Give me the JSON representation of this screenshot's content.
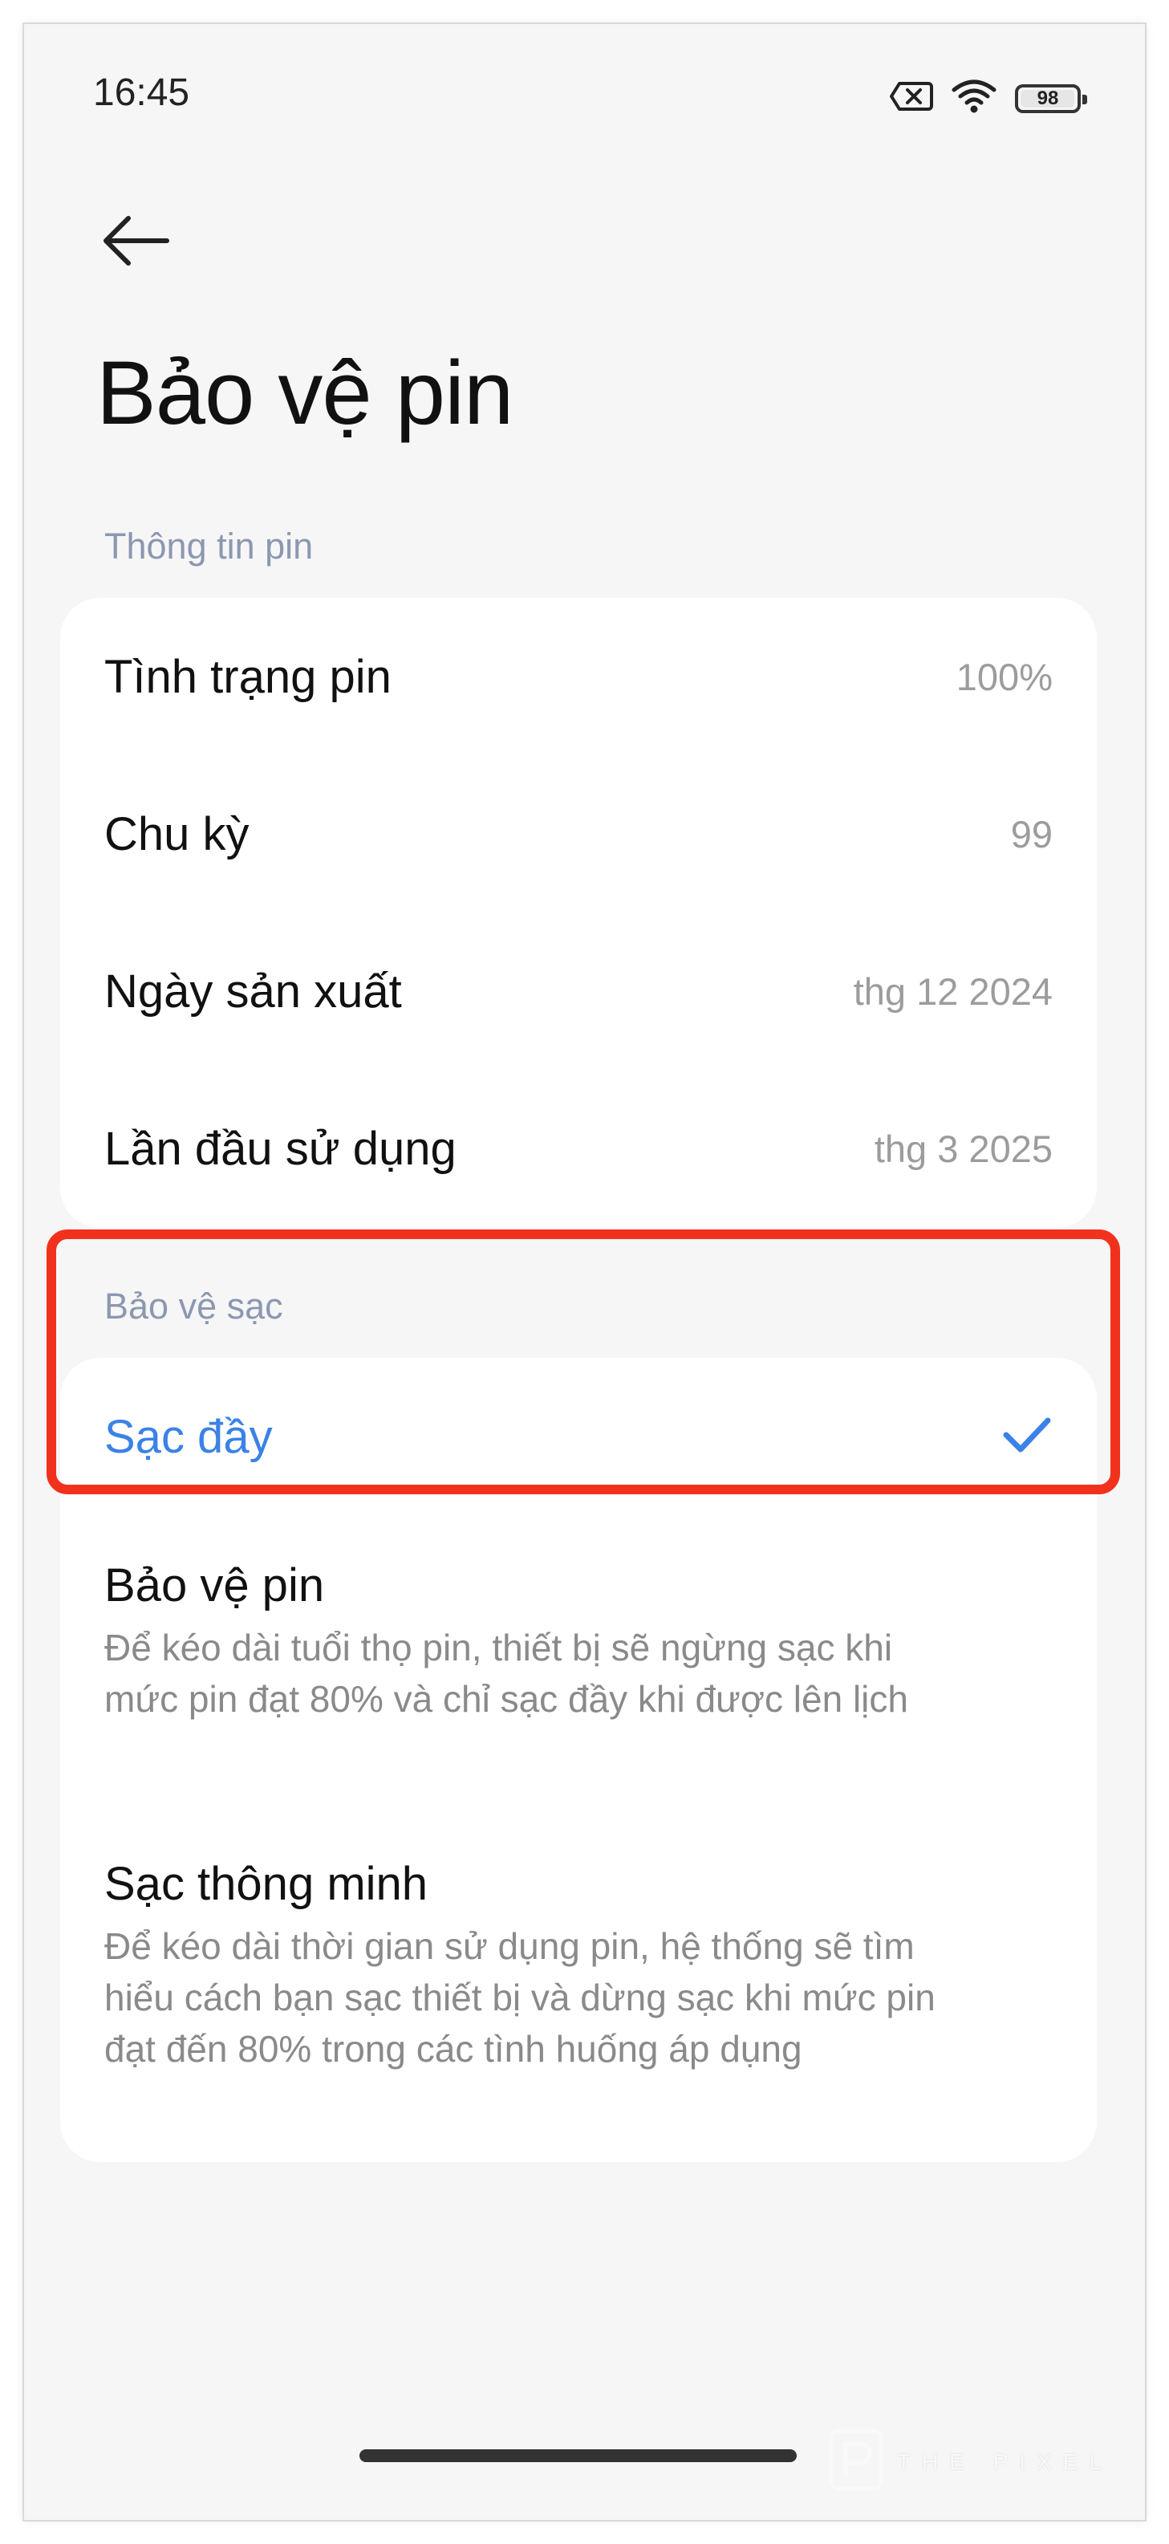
{
  "status_bar": {
    "time": "16:45",
    "battery_level": "98",
    "icons": [
      "sim-off-icon",
      "wifi-icon",
      "battery-icon"
    ]
  },
  "header": {
    "back_icon": "arrow-left-icon",
    "title": "Bảo vệ pin"
  },
  "battery_info": {
    "section_label": "Thông tin pin",
    "rows": [
      {
        "label": "Tình trạng pin",
        "value": "100%"
      },
      {
        "label": "Chu kỳ",
        "value": "99"
      },
      {
        "label": "Ngày sản xuất",
        "value": "thg 12 2024"
      },
      {
        "label": "Lần đầu sử dụng",
        "value": "thg 3 2025"
      }
    ]
  },
  "charge_protection": {
    "section_label": "Bảo vệ sạc",
    "options": [
      {
        "title": "Sạc đầy",
        "selected": true
      },
      {
        "title": "Bảo vệ pin",
        "description": "Để kéo dài tuổi thọ pin, thiết bị sẽ ngừng sạc khi mức pin đạt 80% và chỉ sạc đầy khi được lên lịch",
        "selected": false
      },
      {
        "title": "Sạc thông minh",
        "description": "Để kéo dài thời gian sử dụng pin, hệ thống sẽ tìm hiểu cách bạn sạc thiết bị và dừng sạc khi mức pin đạt đến 80% trong các tình huống áp dụng",
        "selected": false
      }
    ]
  },
  "colors": {
    "accent": "#3b82e6",
    "highlight": "#f2311c",
    "section_label": "#8c97b1",
    "background": "#f6f6f6"
  },
  "watermark": "THE PIXEL"
}
